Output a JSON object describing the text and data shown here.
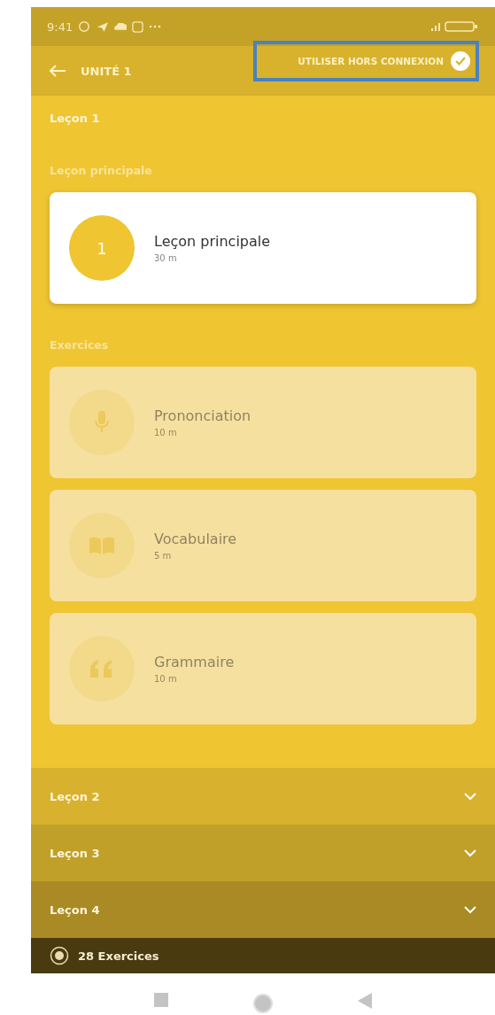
{
  "status_bar": {
    "time": "9:41"
  },
  "header": {
    "title": "UNITÉ 1",
    "offline": {
      "label": "UTILISER HORS CONNEXION",
      "checked": true,
      "highlighted": true
    }
  },
  "lessons": [
    {
      "title": "Leçon 1",
      "expanded": true,
      "sections": [
        {
          "title": "Leçon principale",
          "items": [
            {
              "kind": "number",
              "badge": "1",
              "title": "Leçon principale",
              "duration": "30 m",
              "disabled": false
            }
          ]
        },
        {
          "title": "Exercices",
          "items": [
            {
              "kind": "pronunciation",
              "title": "Prononciation",
              "duration": "10 m",
              "disabled": true
            },
            {
              "kind": "vocabulary",
              "title": "Vocabulaire",
              "duration": "5 m",
              "disabled": true
            },
            {
              "kind": "grammar",
              "title": "Grammaire",
              "duration": "10 m",
              "disabled": true
            }
          ]
        }
      ]
    },
    {
      "title": "Leçon 2",
      "expanded": false
    },
    {
      "title": "Leçon 3",
      "expanded": false
    },
    {
      "title": "Leçon 4",
      "expanded": false
    }
  ],
  "footer": {
    "label": "28 Exercices"
  }
}
